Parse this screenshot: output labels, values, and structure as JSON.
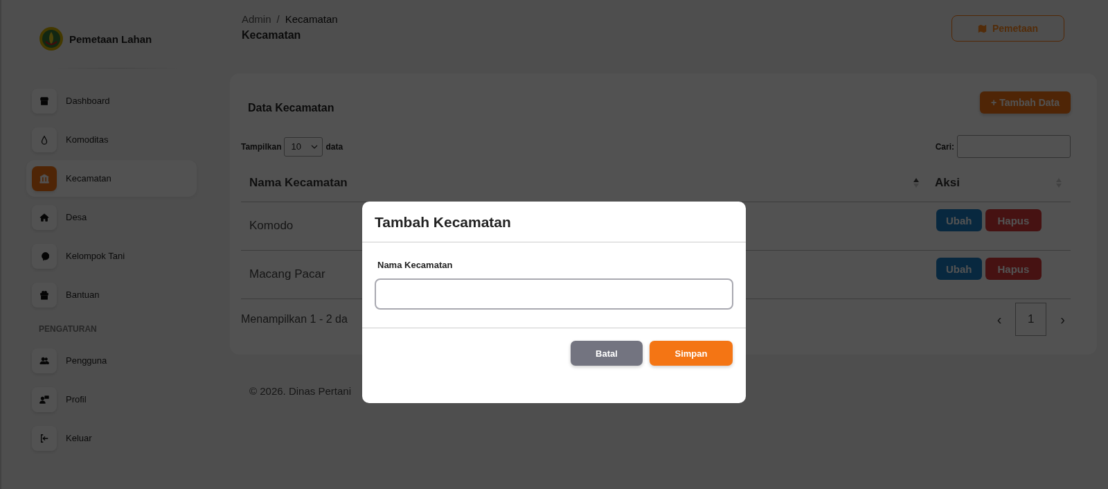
{
  "sidebar": {
    "brand": "Pemetaan Lahan",
    "items": [
      {
        "label": "Dashboard",
        "selected": false
      },
      {
        "label": "Komoditas",
        "selected": false
      },
      {
        "label": "Kecamatan",
        "selected": true
      },
      {
        "label": "Desa",
        "selected": false
      },
      {
        "label": "Kelompok Tani",
        "selected": false
      },
      {
        "label": "Bantuan",
        "selected": false
      }
    ],
    "section_title": "PENGATURAN",
    "settings_items": [
      {
        "label": "Pengguna",
        "selected": false
      },
      {
        "label": "Profil",
        "selected": false
      },
      {
        "label": "Keluar",
        "selected": false
      }
    ]
  },
  "header": {
    "breadcrumb": [
      "Admin",
      "Kecamatan"
    ],
    "breadcrumb_separator": "/",
    "title": "Kecamatan",
    "map_button": "Pemetaan"
  },
  "card": {
    "title": "Data Kecamatan",
    "add_button": "+ Tambah Data",
    "length_label": "Tampilkan",
    "length_value": "10",
    "length_suffix": "data",
    "search_label": "Cari:",
    "columns": [
      {
        "label": "Nama Kecamatan",
        "sorted_ascending": true
      },
      {
        "label": "Aksi",
        "sorted_ascending": false
      }
    ],
    "rows": [
      {
        "name": "Komodo",
        "edit": "Ubah",
        "delete": "Hapus"
      },
      {
        "name": "Macang Pacar",
        "edit": "Ubah",
        "delete": "Hapus"
      }
    ],
    "info": "Menampilkan 1 - 2 da",
    "pagination": {
      "prev": "‹",
      "pages": [
        {
          "label": "1",
          "selected": true
        }
      ],
      "next": "›"
    }
  },
  "footer": "© 2026. Dinas Pertani",
  "modal": {
    "title": "Tambah Kecamatan",
    "field_label": "Nama Kecamatan",
    "cancel": "Batal",
    "save": "Simpan"
  }
}
